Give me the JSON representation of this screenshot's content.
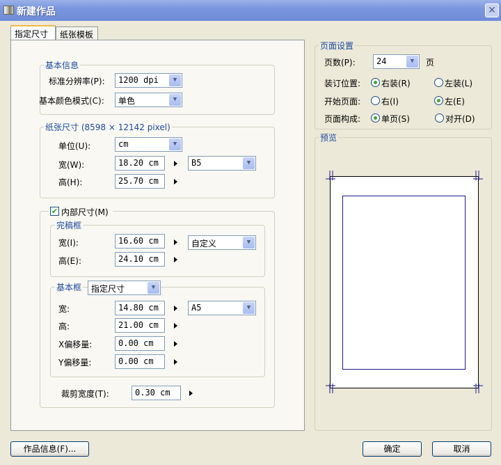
{
  "window": {
    "title": "新建作品",
    "close": "✕"
  },
  "tabs": [
    "指定尺寸",
    "纸张模板"
  ],
  "basic_info": {
    "legend": "基本信息",
    "resolution_label": "标准分辨率(P):",
    "resolution": "1200 dpi",
    "color_mode_label": "基本颜色模式(C):",
    "color_mode": "单色"
  },
  "paper_size": {
    "legend": "纸张尺寸 (8598 × 12142 pixel)",
    "unit_label": "单位(U):",
    "unit": "cm",
    "width_label": "宽(W):",
    "width": "18.20 cm",
    "height_label": "高(H):",
    "height": "25.70 cm",
    "preset": "B5"
  },
  "inner_size": {
    "label": "内部尺寸(M)",
    "checked": true
  },
  "finish_frame": {
    "legend": "完稿框",
    "width_label": "宽(I):",
    "width": "16.60 cm",
    "height_label": "高(E):",
    "height": "24.10 cm",
    "preset": "自定义"
  },
  "basic_frame": {
    "legend": "基本框",
    "mode": "指定尺寸",
    "width_label": "宽:",
    "width": "14.80 cm",
    "height_label": "高:",
    "height": "21.00 cm",
    "x_label": "X偏移量:",
    "x": "0.00 cm",
    "y_label": "Y偏移量:",
    "y": "0.00 cm",
    "preset": "A5"
  },
  "bleed": {
    "label": "裁剪宽度(T):",
    "value": "0.30 cm"
  },
  "page_settings": {
    "legend": "页面设置",
    "pages_label": "页数(P):",
    "pages": "24",
    "pages_unit": "页",
    "binding_label": "装订位置:",
    "binding_right": "右装(R)",
    "binding_left": "左装(L)",
    "binding": "right",
    "start_label": "开始页面:",
    "start_right": "右(I)",
    "start_left": "左(E)",
    "start": "left",
    "layout_label": "页面构成:",
    "layout_single": "单页(S)",
    "layout_spread": "对开(D)",
    "layout": "single"
  },
  "preview": {
    "legend": "预览"
  },
  "buttons": {
    "info": "作品信息(F)...",
    "ok": "确定",
    "cancel": "取消"
  }
}
